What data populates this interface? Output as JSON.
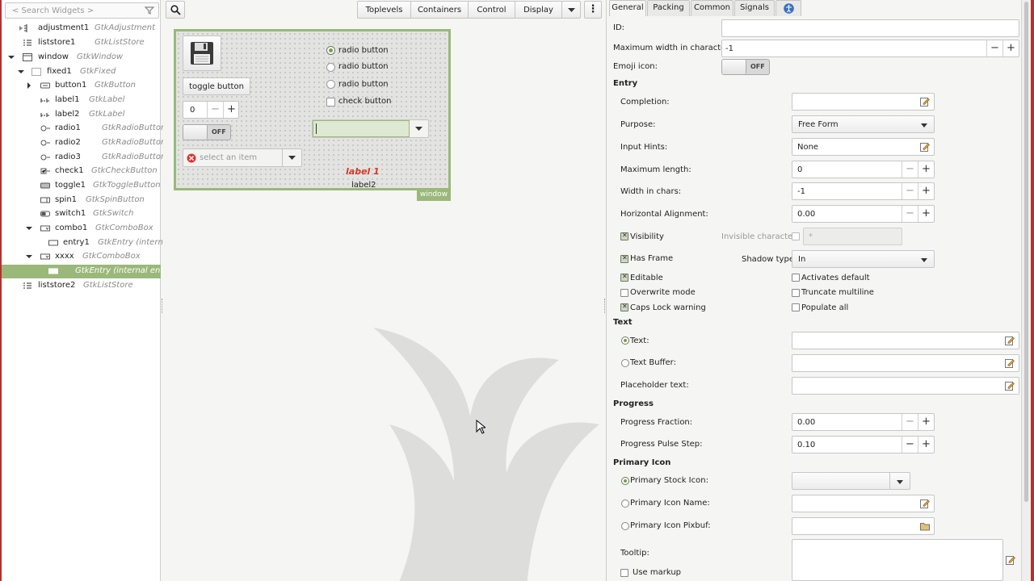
{
  "left": {
    "search_placeholder": "< Search Widgets >",
    "tree": [
      {
        "name": "adjustment1",
        "type": "GtkAdjustment"
      },
      {
        "name": "liststore1",
        "type": "GtkListStore"
      },
      {
        "name": "window",
        "type": "GtkWindow"
      },
      {
        "name": "fixed1",
        "type": "GtkFixed"
      },
      {
        "name": "button1",
        "type": "GtkButton"
      },
      {
        "name": "label1",
        "type": "GtkLabel"
      },
      {
        "name": "label2",
        "type": "GtkLabel"
      },
      {
        "name": "radio1",
        "type": "GtkRadioButton"
      },
      {
        "name": "radio2",
        "type": "GtkRadioButton"
      },
      {
        "name": "radio3",
        "type": "GtkRadioButton"
      },
      {
        "name": "check1",
        "type": "GtkCheckButton"
      },
      {
        "name": "toggle1",
        "type": "GtkToggleButton"
      },
      {
        "name": "spin1",
        "type": "GtkSpinButton"
      },
      {
        "name": "switch1",
        "type": "GtkSwitch"
      },
      {
        "name": "combo1",
        "type": "GtkComboBox"
      },
      {
        "name": "entry1",
        "type": "GtkEntry (intern..."
      },
      {
        "name": "xxxx",
        "type": "GtkComboBox"
      },
      {
        "name": "",
        "type": "GtkEntry  (internal entry)"
      },
      {
        "name": "liststore2",
        "type": "GtkListStore"
      }
    ]
  },
  "toolbar": {
    "items": [
      "Toplevels",
      "Containers",
      "Control",
      "Display"
    ],
    "more": "⋮"
  },
  "design": {
    "toggle_label": "toggle button",
    "spin_value": "0",
    "minus": "−",
    "plus": "+",
    "switch_text": "OFF",
    "combo_placeholder": "select an item",
    "radio_labels": [
      "radio button",
      "radio button",
      "radio button"
    ],
    "check_label": "check button",
    "label1": "label 1",
    "label2": "label2",
    "window_tag": "window"
  },
  "props": {
    "tabs": [
      "General",
      "Packing",
      "Common",
      "Signals"
    ],
    "id_label": "ID:",
    "id_value": "",
    "maxwidth_label": "Maximum width in characters:",
    "maxwidth_value": "-1",
    "emoji_label": "Emoji icon:",
    "emoji_switch": "OFF",
    "entry_section": "Entry",
    "completion_label": "Completion:",
    "purpose_label": "Purpose:",
    "purpose_value": "Free Form",
    "hints_label": "Input Hints:",
    "hints_value": "None",
    "maxlen_label": "Maximum length:",
    "maxlen_value": "0",
    "wchars_label": "Width in chars:",
    "wchars_value": "-1",
    "halign_label": "Horizontal Alignment:",
    "halign_value": "0.00",
    "visibility_label": "Visibility",
    "invis_label": "Invisible character:",
    "invis_value": "*",
    "hasframe_label": "Has Frame",
    "shadow_label": "Shadow type:",
    "shadow_value": "In",
    "editable_label": "Editable",
    "activates_label": "Activates default",
    "overwrite_label": "Overwrite mode",
    "truncate_label": "Truncate multiline",
    "capslock_label": "Caps Lock warning",
    "populate_label": "Populate all",
    "text_section": "Text",
    "text_label": "Text:",
    "textbuffer_label": "Text Buffer:",
    "placeholder_label": "Placeholder text:",
    "progress_section": "Progress",
    "pfraction_label": "Progress Fraction:",
    "pfraction_value": "0.00",
    "ppulse_label": "Progress Pulse Step:",
    "ppulse_value": "0.10",
    "primary_section": "Primary Icon",
    "pstock_label": "Primary Stock Icon:",
    "pname_label": "Primary Icon Name:",
    "ppixbuf_label": "Primary Icon Pixbuf:",
    "tooltip_label": "Tooltip:",
    "markup_label": "Use markup",
    "minus": "−",
    "plus": "+"
  },
  "colors": {
    "accent": "#9ab87a",
    "label1_red": "#d23a2a"
  }
}
